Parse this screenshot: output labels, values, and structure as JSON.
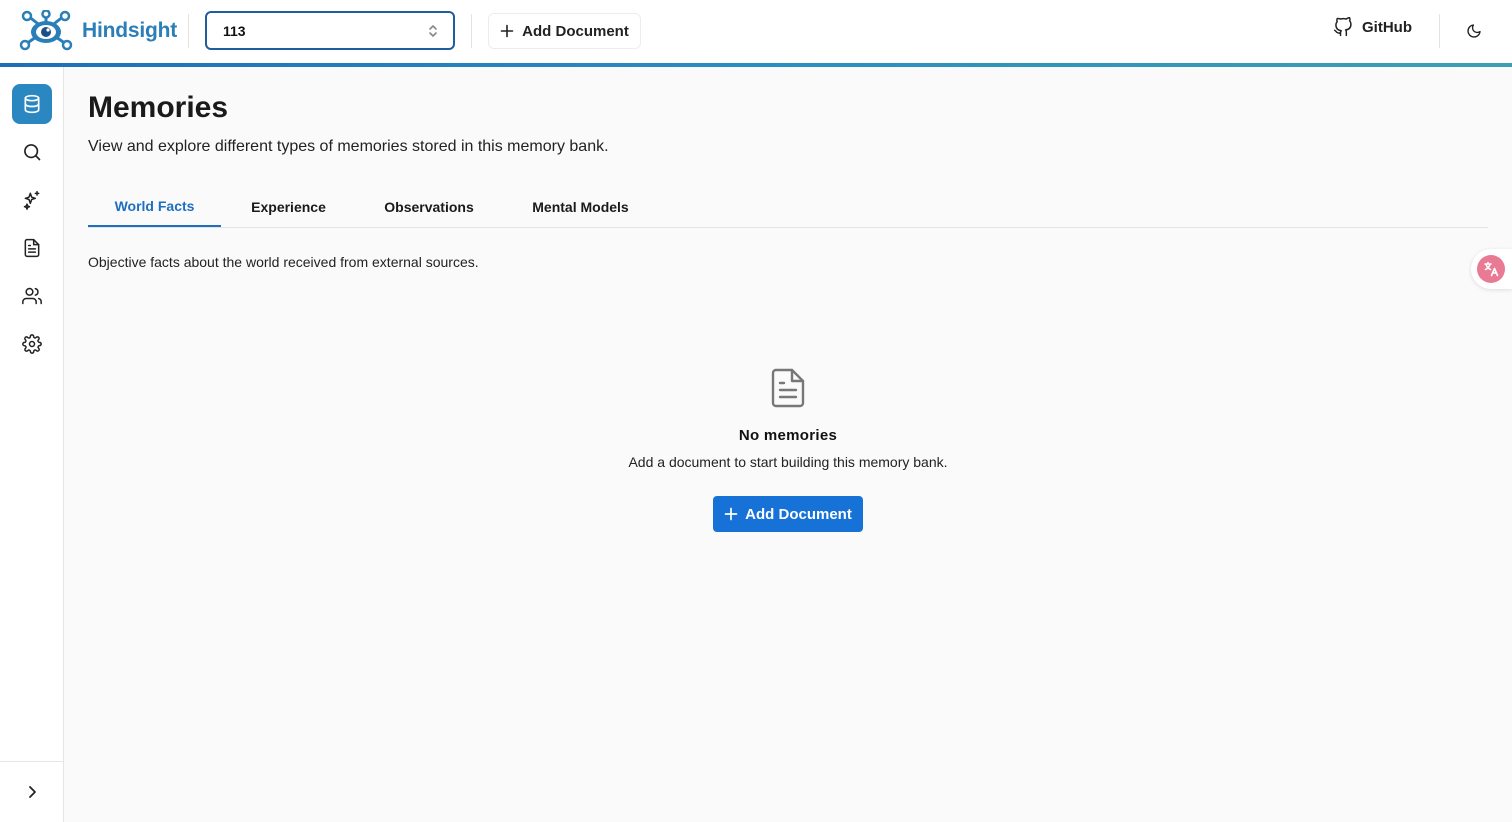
{
  "header": {
    "logo_text": "Hindsight",
    "bank_selector_value": "113",
    "add_document_label": "Add Document",
    "github_label": "GitHub"
  },
  "sidebar": {
    "items": [
      {
        "name": "memories",
        "icon": "database-icon",
        "active": true
      },
      {
        "name": "search",
        "icon": "search-icon",
        "active": false
      },
      {
        "name": "reflect",
        "icon": "sparkles-icon",
        "active": false
      },
      {
        "name": "documents",
        "icon": "file-text-icon",
        "active": false
      },
      {
        "name": "entities",
        "icon": "users-icon",
        "active": false
      },
      {
        "name": "settings",
        "icon": "gear-icon",
        "active": false
      }
    ]
  },
  "main": {
    "title": "Memories",
    "subtitle": "View and explore different types of memories stored in this memory bank.",
    "tabs": [
      {
        "label": "World Facts",
        "active": true
      },
      {
        "label": "Experience",
        "active": false
      },
      {
        "label": "Observations",
        "active": false
      },
      {
        "label": "Mental Models",
        "active": false
      }
    ],
    "tab_description": "Objective facts about the world received from external sources.",
    "empty_state": {
      "title": "No memories",
      "description": "Add a document to start building this memory bank.",
      "button_label": "Add Document"
    }
  },
  "colors": {
    "accent": "#1672d6",
    "brand": "#2a7fb8",
    "sidebar_active": "#2a87c0"
  }
}
